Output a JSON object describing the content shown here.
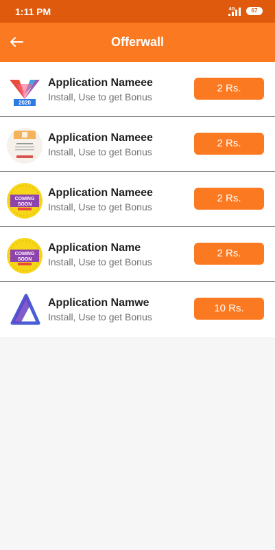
{
  "status_bar": {
    "time": "1:11 PM",
    "network": "4G",
    "battery": "67",
    "signal_icon": "signal-icon"
  },
  "header": {
    "title": "Offerwall",
    "back_icon": "arrow-left-icon",
    "background_color": "#fb7a21"
  },
  "offers": [
    {
      "name": "Application Nameee",
      "subtitle": "Install, Use to get Bonus",
      "reward": "2 Rs.",
      "icon": "colorful-v-logo-2020"
    },
    {
      "name": "Application Nameee",
      "subtitle": "Install, Use to get Bonus",
      "reward": "2 Rs.",
      "icon": "document-screenshot"
    },
    {
      "name": "Application Nameee",
      "subtitle": "Install, Use to get Bonus",
      "reward": "2 Rs.",
      "icon": "coming-soon-badge",
      "thumb_text": "COMING SOON"
    },
    {
      "name": "Application Name",
      "subtitle": "Install, Use to get Bonus",
      "reward": "2 Rs.",
      "icon": "coming-soon-badge",
      "thumb_text": "COMING SOON"
    },
    {
      "name": "Application Namwe",
      "subtitle": "Install, Use to get Bonus",
      "reward": "10 Rs.",
      "icon": "triangle-logo"
    }
  ],
  "colors": {
    "accent": "#fb7a21",
    "status_bar": "#e05a0e"
  }
}
